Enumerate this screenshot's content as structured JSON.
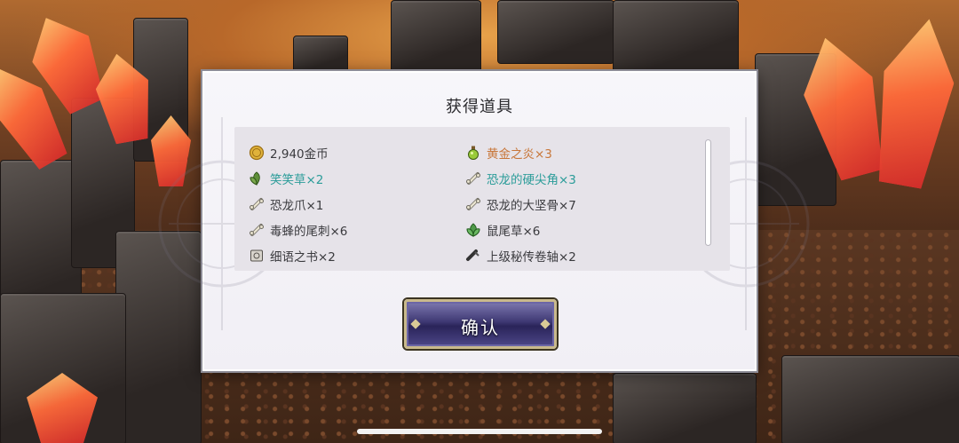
{
  "dialog": {
    "title": "获得道具",
    "confirm_label": "确认",
    "scroll_position": 0
  },
  "colors": {
    "normal": "#3a3a3e",
    "highlight_gold": "#c8773a",
    "highlight_teal": "#2b9c99"
  },
  "items": {
    "left": [
      {
        "label": "2,940金币",
        "icon": "gold-coin-icon",
        "color": "normal"
      },
      {
        "label": "笑笑草×2",
        "icon": "herb-icon",
        "color": "teal"
      },
      {
        "label": "恐龙爪×1",
        "icon": "bone-icon",
        "color": "normal"
      },
      {
        "label": "毒蜂的尾刺×6",
        "icon": "bone-icon",
        "color": "normal"
      },
      {
        "label": "细语之书×2",
        "icon": "book-icon",
        "color": "normal"
      }
    ],
    "right": [
      {
        "label": "黄金之炎×3",
        "icon": "potion-icon",
        "color": "gold"
      },
      {
        "label": "恐龙的硬尖角×3",
        "icon": "bone-icon",
        "color": "teal"
      },
      {
        "label": "恐龙的大坚骨×7",
        "icon": "bone-icon",
        "color": "normal"
      },
      {
        "label": "鼠尾草×6",
        "icon": "herb-icon",
        "color": "normal"
      },
      {
        "label": "上级秘传卷轴×2",
        "icon": "scroll-icon",
        "color": "normal"
      }
    ]
  }
}
